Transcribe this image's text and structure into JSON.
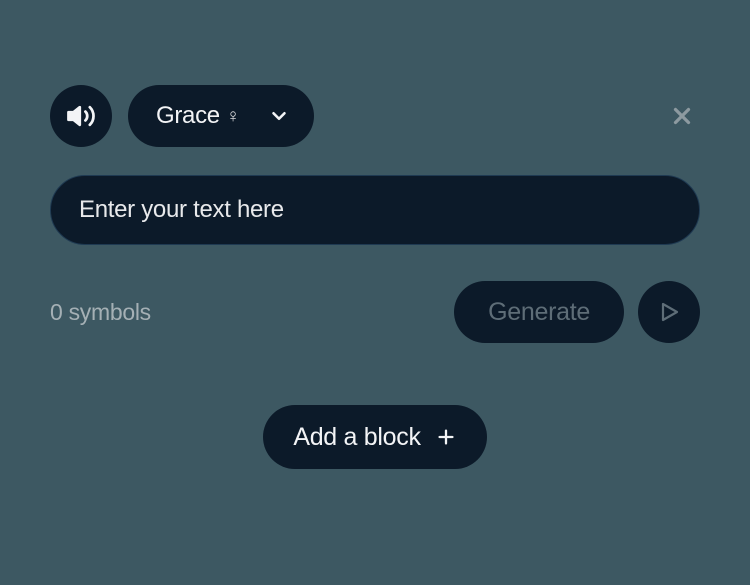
{
  "colors": {
    "bg": "#3d5862",
    "pill": "#0c1a29",
    "text_light": "#f3f4f6",
    "text_muted": "#a5b0b5",
    "text_disabled": "#5e6d77"
  },
  "voice": {
    "selected_name": "Grace",
    "gender_symbol": "♀"
  },
  "input": {
    "placeholder": "Enter your text here",
    "value": ""
  },
  "status": {
    "symbol_count_text": "0 symbols"
  },
  "buttons": {
    "generate_label": "Generate",
    "add_block_label": "Add a block"
  },
  "icons": {
    "speaker": "speaker-icon",
    "chevron_down": "chevron-down-icon",
    "close": "close-icon",
    "play": "play-icon",
    "plus": "plus-icon"
  }
}
